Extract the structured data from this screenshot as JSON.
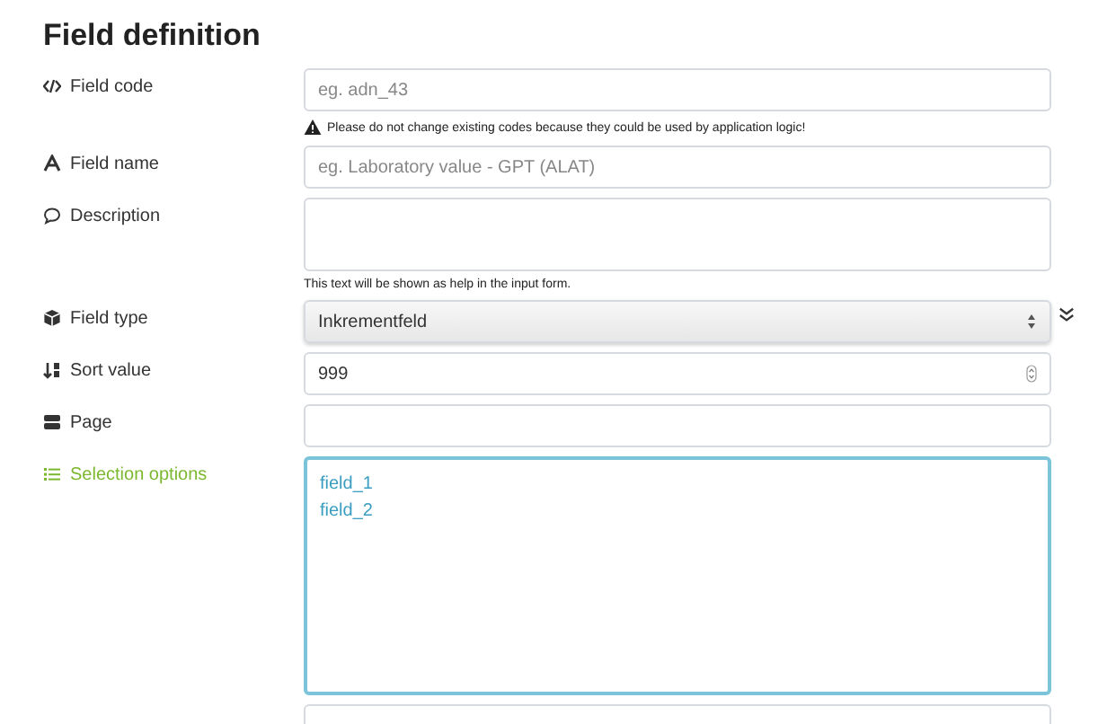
{
  "title": "Field definition",
  "fields": [
    {
      "kind": "text",
      "label": "Field code",
      "placeholder": "eg. adn_43",
      "hint": "Please do not change existing codes because they could be used by application logic!",
      "hint_warning": true,
      "focused": false
    },
    {
      "kind": "text",
      "label": "Field name",
      "placeholder": "eg. Laboratory value - GPT (ALAT)",
      "focused": false
    },
    {
      "kind": "textarea",
      "label": "Description",
      "hint": "This text will be shown as help in the input form.",
      "hint_warning": false,
      "focused": false
    },
    {
      "kind": "select",
      "label": "Field type",
      "value": "Inkrementfeld",
      "focused": false
    },
    {
      "kind": "number",
      "label": "Sort value",
      "value": "999",
      "focused": false
    },
    {
      "kind": "text",
      "label": "Page",
      "focused": false
    },
    {
      "kind": "bigtextarea",
      "label": "Selection options",
      "value": "field_1\nfield_2",
      "focused": true
    },
    {
      "kind": "text",
      "focused": false
    }
  ]
}
